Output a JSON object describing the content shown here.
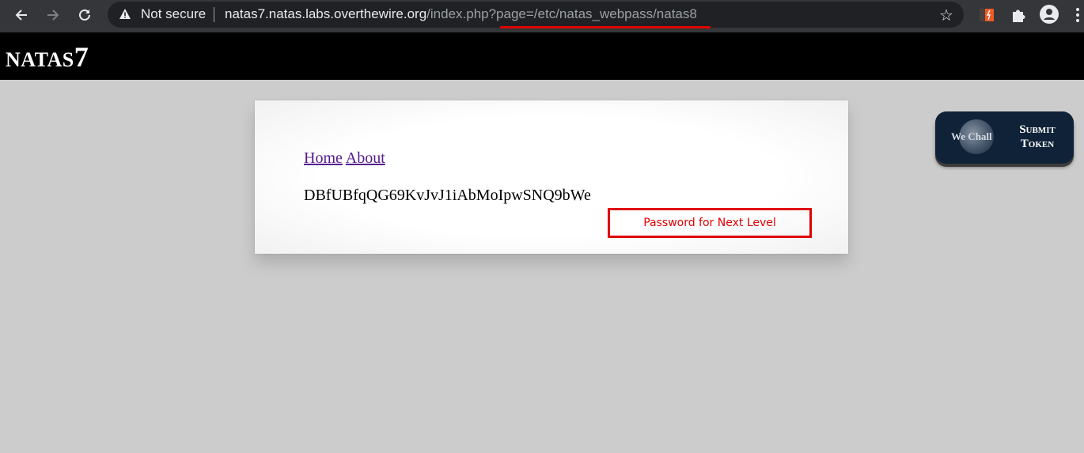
{
  "browser": {
    "nav": {
      "back_icon": "arrow-left-icon",
      "forward_icon": "arrow-right-icon",
      "reload_icon": "reload-icon"
    },
    "omnibox": {
      "security_icon": "warning-triangle-icon",
      "security_label": "Not secure",
      "url_host": "natas7.natas.labs.overthewire.org",
      "url_path": "/index.php?page=/etc/natas_webpass/natas8"
    },
    "toolbar": {
      "bookmark_icon": "star-icon",
      "extension_icon": "extension-icon",
      "extensions_icon": "puzzle-icon",
      "profile_icon": "account-circle-icon",
      "menu_icon": "kebab-menu-icon"
    },
    "colors": {
      "chrome_bg": "#35363a",
      "omnibox_bg": "#202124",
      "annotation_red": "#e00000"
    }
  },
  "page": {
    "header": {
      "title_prefix": "NATAS",
      "title_number": "7"
    },
    "nav_links": [
      {
        "label": "Home"
      },
      {
        "label": "About"
      }
    ],
    "password": "DBfUBfqQG69KvJvJ1iAbMoIpwSNQ9bWe",
    "annotation_label": "Password for Next Level",
    "wechall": {
      "brand": "We Chall",
      "line1": "Submit",
      "line2": "Token"
    },
    "colors": {
      "background": "#cccccc",
      "header_bg": "#000000",
      "link": "#551a8b"
    }
  }
}
